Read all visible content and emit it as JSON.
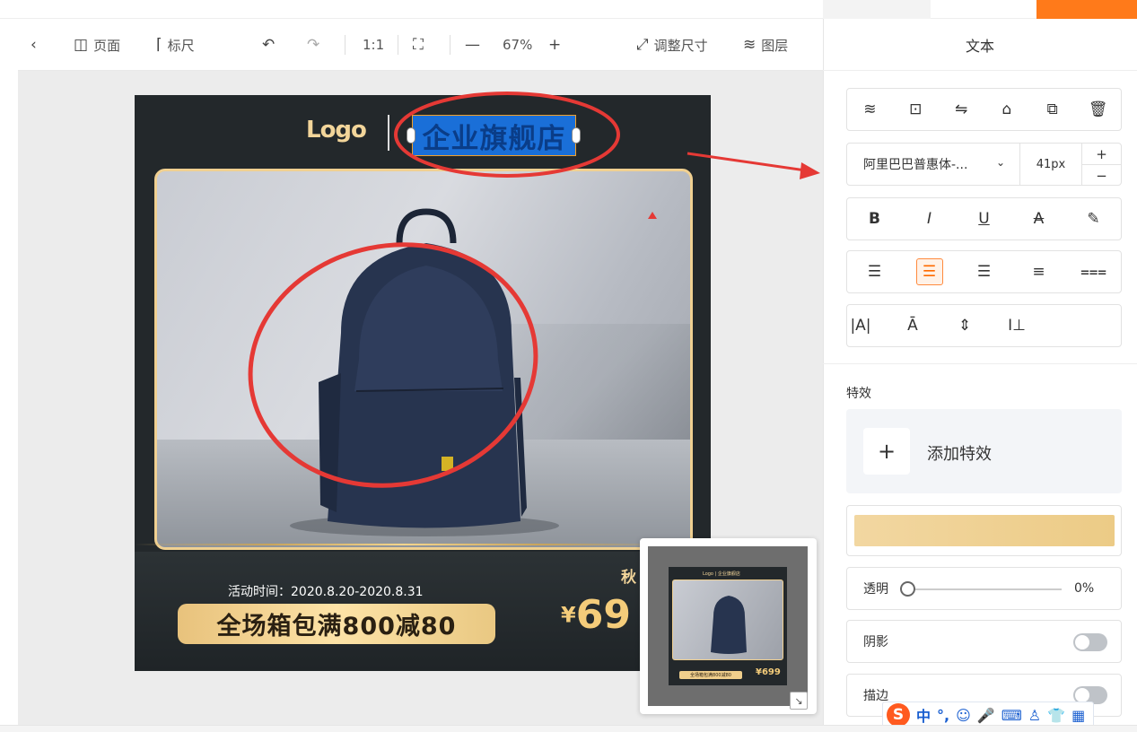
{
  "toolbar": {
    "back_icon": "chevron-left-icon",
    "page_label": "页面",
    "ruler_label": "标尺",
    "zoom_reset": "1:1",
    "zoom_value": "67%",
    "resize_label": "调整尺寸",
    "layers_label": "图层"
  },
  "poster": {
    "logo": "Logo",
    "shop_name": "企业旗舰店",
    "event_time": "活动时间：2020.8.20-2020.8.31",
    "promo": "全场箱包满800减80",
    "season": "秋",
    "price_currency": "¥",
    "price_value": "69"
  },
  "minimap": {
    "logo": "Logo | 企业旗舰店",
    "promo": "全场箱包满800减80",
    "price": "¥699"
  },
  "panel": {
    "title": "文本",
    "font_family": "阿里巴巴普惠体-...",
    "font_size": "41px",
    "plus": "+",
    "minus": "−",
    "effects_label": "特效",
    "add_effect": "添加特效",
    "opacity_label": "透明",
    "opacity_value": "0%",
    "opacity_level": 0,
    "shadow_label": "阴影",
    "shadow_on": false,
    "stroke_label": "描边",
    "stroke_on": false,
    "gradient_colors": [
      "#f2d7a1",
      "#eccb86"
    ],
    "format_buttons": [
      "B",
      "I",
      "U",
      "A",
      "highlighter-icon"
    ],
    "align_buttons": [
      "align-left-icon",
      "align-center-icon",
      "align-right-icon",
      "align-justify-icon",
      "align-distribute-icon"
    ],
    "align_active": "align-center-icon",
    "spacing_buttons": [
      "letter-spacing-icon",
      "line-height-top-icon",
      "line-height-middle-icon",
      "paragraph-spacing-icon"
    ]
  },
  "ime": {
    "mode": "中",
    "punct": "°,"
  },
  "colors": {
    "accent": "#ff6a00",
    "poster_bg": "#23282b",
    "gold": "#f2d59a",
    "annotation": "#e53935"
  }
}
